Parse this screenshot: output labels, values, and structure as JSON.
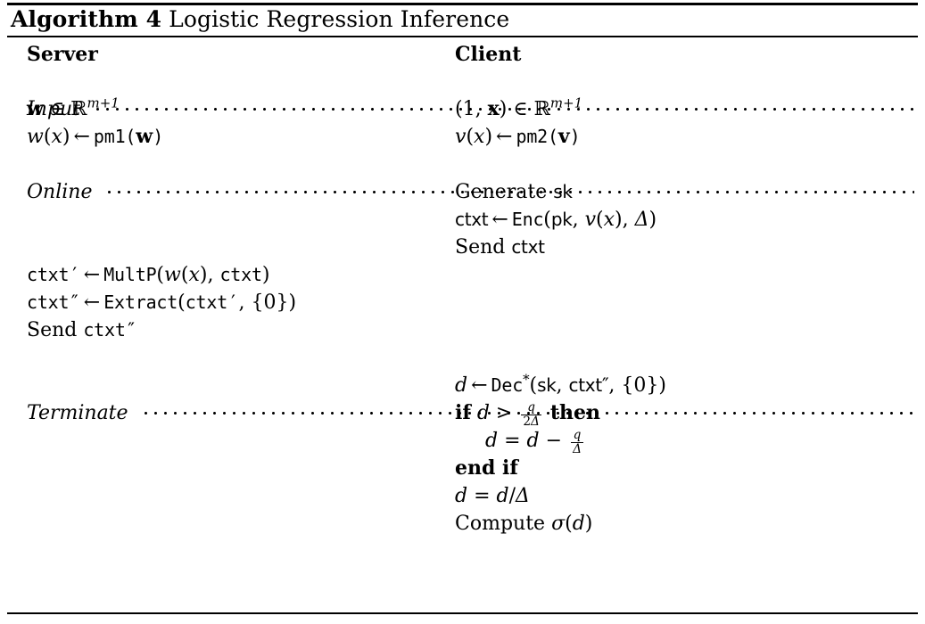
{
  "title": {
    "keyword": "Algorithm 4",
    "caption": "Logistic Regression Inference"
  },
  "columns": {
    "server_header": "Server",
    "client_header": "Client"
  },
  "phases": [
    {
      "name": "Input"
    },
    {
      "name": "Online"
    },
    {
      "name": "Terminate"
    }
  ],
  "server": {
    "input": [
      {
        "text": "w ∈ ℝ^{m+1}"
      },
      {
        "text": "w(x) ← pm1(w)"
      }
    ],
    "online": [
      {
        "text": "ctxt′ ← MultP(w(x), ctxt)"
      },
      {
        "text": "ctxt″ ← Extract(ctxt′, {0})"
      },
      {
        "text": "Send ctxt″"
      }
    ]
  },
  "client": {
    "input": [
      {
        "text": "(1, x) ∈ ℝ^{m+1}"
      },
      {
        "text": "v(x) ← pm2(v)"
      }
    ],
    "online": [
      {
        "text": "Generate sk"
      },
      {
        "text": "ctxt ← Enc(pk, v(x), Δ)"
      },
      {
        "text": "Send ctxt"
      }
    ],
    "terminate": [
      {
        "text": "d ← Dec*(sk, ctxt″, {0})"
      },
      {
        "text": "if d > q/(2Δ) then"
      },
      {
        "text": "d = d − q/Δ"
      },
      {
        "text": "end if"
      },
      {
        "text": "d = d/Δ"
      },
      {
        "text": "Compute σ(d)"
      }
    ]
  },
  "tokens": {
    "w_bold": "w",
    "x_bold": "x",
    "v_bold": "v",
    "R": "ℝ",
    "exp_m1": "m+1",
    "in": "∈",
    "leftarrow": "←",
    "pm1": "pm1",
    "pm2": "pm2",
    "sk": "sk",
    "pk": "pk",
    "ctxt": "ctxt",
    "Enc": "Enc",
    "Dec": "Dec",
    "MultP": "MultP",
    "Extract": "Extract",
    "Generate": "Generate",
    "Send": "Send",
    "Compute": "Compute",
    "if": "if",
    "then": "then",
    "end_if": "end if",
    "delta": "Δ",
    "sigma": "σ",
    "q": "q",
    "d": "d",
    "gt": ">",
    "eq": "=",
    "minus": "−",
    "slash": "/",
    "star": "*",
    "prime": "′",
    "dprime": "″",
    "set0": "{0}",
    "one": "1",
    "two": "2"
  },
  "colors": {
    "text": "#000000",
    "rule": "#000000",
    "background": "#ffffff"
  }
}
